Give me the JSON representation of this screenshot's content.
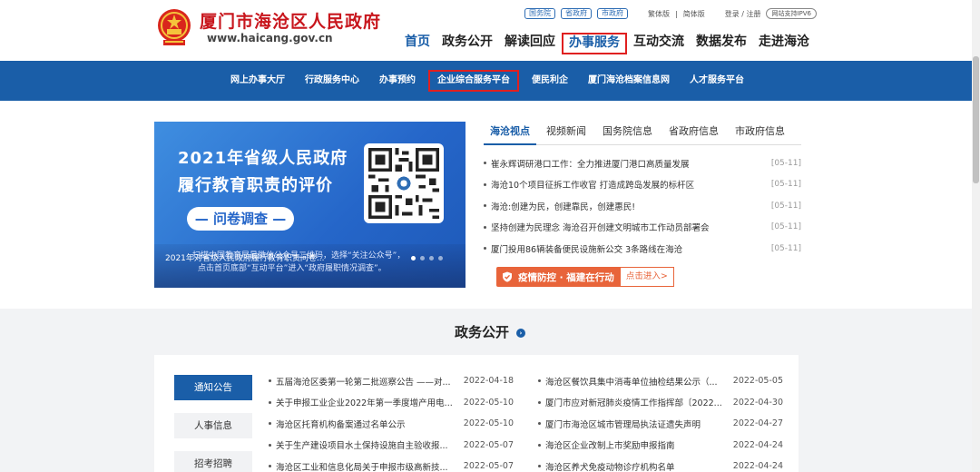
{
  "header": {
    "site_title": "厦门市海沧区人民政府",
    "site_url": "www.haicang.gov.cn",
    "top_links": {
      "gov_badges": [
        "国务院",
        "省政府",
        "市政府"
      ],
      "traditional": "繁体版",
      "simplified": "简体版",
      "separator": "|",
      "login": "登录 / 注册",
      "ipv6": "网站支持IPV6"
    },
    "main_nav": [
      "首页",
      "政务公开",
      "解读回应",
      "办事服务",
      "互动交流",
      "数据发布",
      "走进海沧"
    ]
  },
  "sub_nav": [
    "网上办事大厅",
    "行政服务中心",
    "办事预约",
    "企业综合服务平台",
    "便民利企",
    "厦门海沧档案信息网",
    "人才服务平台"
  ],
  "banner": {
    "line1": "2021年省级人民政府",
    "line2": "履行教育职责的评价",
    "pill": "— 问卷调查 —",
    "sub1": "扫描中国教育局最微信公众号二维码，选择“关注公众号”，",
    "sub2": "点击首页底部“互动平台”进入“政府履职情况调查”。",
    "caption": "2021年对省级人民政府履行教育职责问卷..."
  },
  "news": {
    "tabs": [
      "海沧视点",
      "视频新闻",
      "国务院信息",
      "省政府信息",
      "市政府信息"
    ],
    "items": [
      {
        "title": "崔永辉调研港口工作：全力推进厦门港口高质量发展",
        "date": "[05-11]"
      },
      {
        "title": "海沧10个项目征拆工作收官 打造成跨岛发展的标杆区",
        "date": "[05-11]"
      },
      {
        "title": "海沧:创建为民，创建靠民，创建惠民!",
        "date": "[05-11]"
      },
      {
        "title": "坚持创建为民理念 海沧召开创建文明城市工作动员部署会",
        "date": "[05-11]"
      },
      {
        "title": "厦门投用86辆装备便民设施新公交 3条路线在海沧",
        "date": "[05-11]"
      }
    ]
  },
  "epidemic": {
    "label": "疫情防控 · 福建在行动",
    "button": "点击进入>"
  },
  "gov": {
    "title": "政务公开",
    "side_tabs": [
      "通知公告",
      "人事信息",
      "招考招聘"
    ],
    "left_items": [
      {
        "title": "五届海沧区委第一轮第二批巡察公告 ——对...",
        "date": "2022-04-18"
      },
      {
        "title": "关于申报工业企业2022年第一季度增产用电...",
        "date": "2022-05-10"
      },
      {
        "title": "海沧区托育机构备案通过名单公示",
        "date": "2022-05-10"
      },
      {
        "title": "关于生产建设项目水土保持设施自主验收报...",
        "date": "2022-05-07"
      },
      {
        "title": "海沧区工业和信息化局关于申报市级高新技...",
        "date": "2022-05-07"
      }
    ],
    "right_items": [
      {
        "title": "海沧区餐饮具集中消毒单位抽检结果公示（...",
        "date": "2022-05-05"
      },
      {
        "title": "厦门市应对新冠肺炎疫情工作指挥部〔2022...",
        "date": "2022-04-30"
      },
      {
        "title": "厦门市海沧区城市管理局执法证遗失声明",
        "date": "2022-04-27"
      },
      {
        "title": "海沧区企业改制上市奖励申报指南",
        "date": "2022-04-24"
      },
      {
        "title": "海沧区养犬免疫动物诊疗机构名单",
        "date": "2022-04-24"
      }
    ]
  },
  "colors": {
    "primary_blue": "#1a5ea8",
    "title_red": "#c8161d",
    "highlight_red": "#e02020",
    "epidemic_orange": "#e8643a"
  }
}
